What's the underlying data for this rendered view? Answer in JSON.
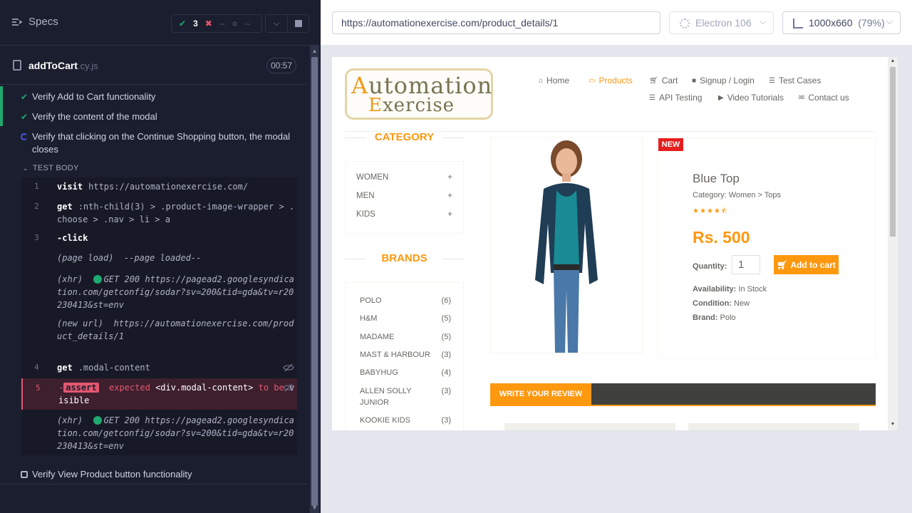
{
  "reporter": {
    "specs_label": "Specs",
    "stats": {
      "passed": "3",
      "failed": "--",
      "pending": "--"
    },
    "spec_file": {
      "name": "addToCart",
      "ext": ".cy.js",
      "duration": "00:57"
    },
    "tests": [
      {
        "title": "Verify Add to Cart functionality",
        "state": "passed"
      },
      {
        "title": "Verify the content of the modal",
        "state": "passed"
      },
      {
        "title": "Verify that clicking on the Continue Shopping button, the modal closes",
        "state": "running"
      }
    ],
    "test_body_label": "TEST BODY",
    "commands": {
      "c1": {
        "num": "1",
        "name": "visit",
        "msg": "https://automationexercise.com/"
      },
      "c2": {
        "num": "2",
        "name": "get",
        "msg": ":nth-child(3) > .product-image-wrapper > .choose > .nav > li > a"
      },
      "c3": {
        "num": "3",
        "name": "-click"
      },
      "page_load": {
        "name": "(page load)",
        "msg": "--page loaded--"
      },
      "xhr1": {
        "name": "(xhr)",
        "status": "GET 200",
        "url": "https://pagead2.googlesyndication.com/getconfig/sodar?sv=200&tid=gda&tv=r20230413&st=env"
      },
      "newurl": {
        "name": "(new url)",
        "url": "https://automationexercise.com/product_details/1"
      },
      "c4": {
        "num": "4",
        "name": "get",
        "msg": ".modal-content"
      },
      "c5": {
        "num": "5",
        "dash": "-",
        "badge": "assert",
        "expected": "expected",
        "subject": "<div.modal-content>",
        "to": "to",
        "be": "be",
        "visible": "visible"
      },
      "xhr2": {
        "name": "(xhr)",
        "status": "GET 200",
        "url": "https://pagead2.googlesyndication.com/getconfig/sodar?sv=200&tid=gda&tv=r20230413&st=env"
      }
    },
    "pending_test": "Verify View Product button functionality"
  },
  "aut": {
    "url": "https://automationexercise.com/product_details/1",
    "browser": "Electron 106",
    "viewport": "1000x660",
    "zoom": "(79%)"
  },
  "site": {
    "logo": {
      "line1_cap": "A",
      "line1_rest": "utomation",
      "line2_cap": "E",
      "line2_rest": "xercise"
    },
    "nav": {
      "home": "Home",
      "products": "Products",
      "cart": "Cart",
      "signup": "Signup / Login",
      "test_cases": "Test Cases",
      "api_testing": "API Testing",
      "video": "Video Tutorials",
      "contact": "Contact us"
    },
    "category_title": "CATEGORY",
    "categories": [
      "WOMEN",
      "MEN",
      "KIDS"
    ],
    "brands_title": "BRANDS",
    "brands": [
      {
        "name": "POLO",
        "count": "(6)"
      },
      {
        "name": "H&M",
        "count": "(5)"
      },
      {
        "name": "MADAME",
        "count": "(5)"
      },
      {
        "name": "MAST & HARBOUR",
        "count": "(3)"
      },
      {
        "name": "BABYHUG",
        "count": "(4)"
      },
      {
        "name": "ALLEN SOLLY JUNIOR",
        "count": "(3)"
      },
      {
        "name": "KOOKIE KIDS",
        "count": "(3)"
      }
    ],
    "product": {
      "badge": "NEW",
      "name": "Blue Top",
      "category": "Category: Women > Tops",
      "rating": 4.5,
      "price": "Rs. 500",
      "quantity_label": "Quantity:",
      "quantity": "1",
      "add_to_cart": "Add to cart",
      "availability_label": "Availability:",
      "availability": "In Stock",
      "condition_label": "Condition:",
      "condition": "New",
      "brand_label": "Brand:",
      "brand": "Polo"
    },
    "review_tab": "WRITE YOUR REVIEW",
    "colors": {
      "accent": "#FE980F",
      "pass": "#1FA971",
      "fail": "#E45770"
    }
  }
}
